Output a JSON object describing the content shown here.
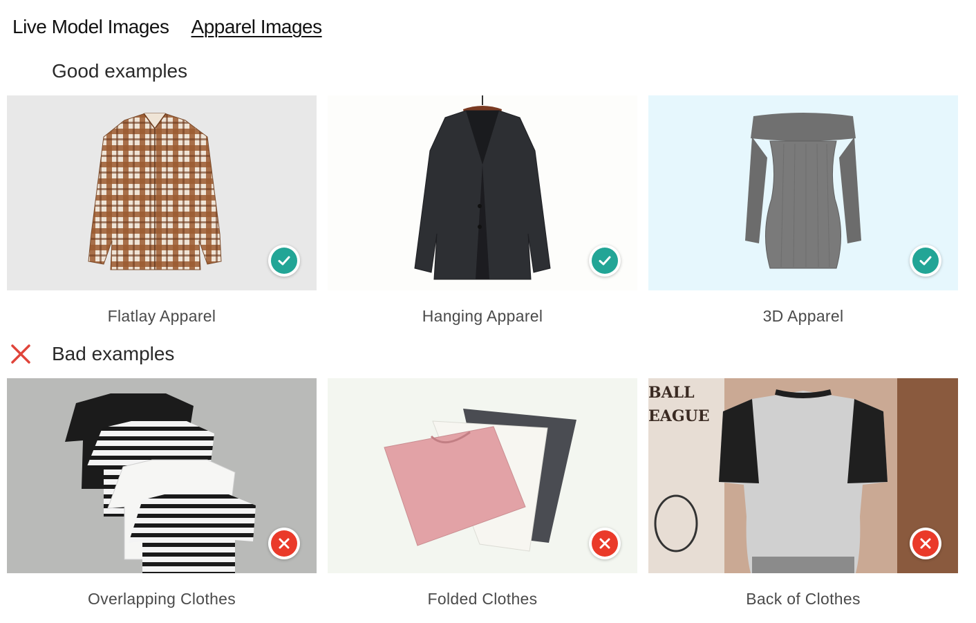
{
  "tabs": [
    {
      "label": "Live Model Images",
      "active": false
    },
    {
      "label": "Apparel Images",
      "active": true
    }
  ],
  "good": {
    "title": "Good examples",
    "items": [
      {
        "caption": "Flatlay Apparel",
        "status": "check-icon"
      },
      {
        "caption": "Hanging Apparel",
        "status": "check-icon"
      },
      {
        "caption": "3D Apparel",
        "status": "check-icon"
      }
    ]
  },
  "bad": {
    "title": "Bad examples",
    "icon": "cross-icon",
    "items": [
      {
        "caption": "Overlapping Clothes",
        "status": "error-icon"
      },
      {
        "caption": "Folded Clothes",
        "status": "error-icon"
      },
      {
        "caption": "Back of Clothes",
        "status": "error-icon"
      }
    ],
    "backdrop_text": [
      "BALL",
      "EAGUE"
    ]
  },
  "colors": {
    "check": "#22a596",
    "error": "#ea3a2a",
    "bad_mark": "#e0443a"
  }
}
